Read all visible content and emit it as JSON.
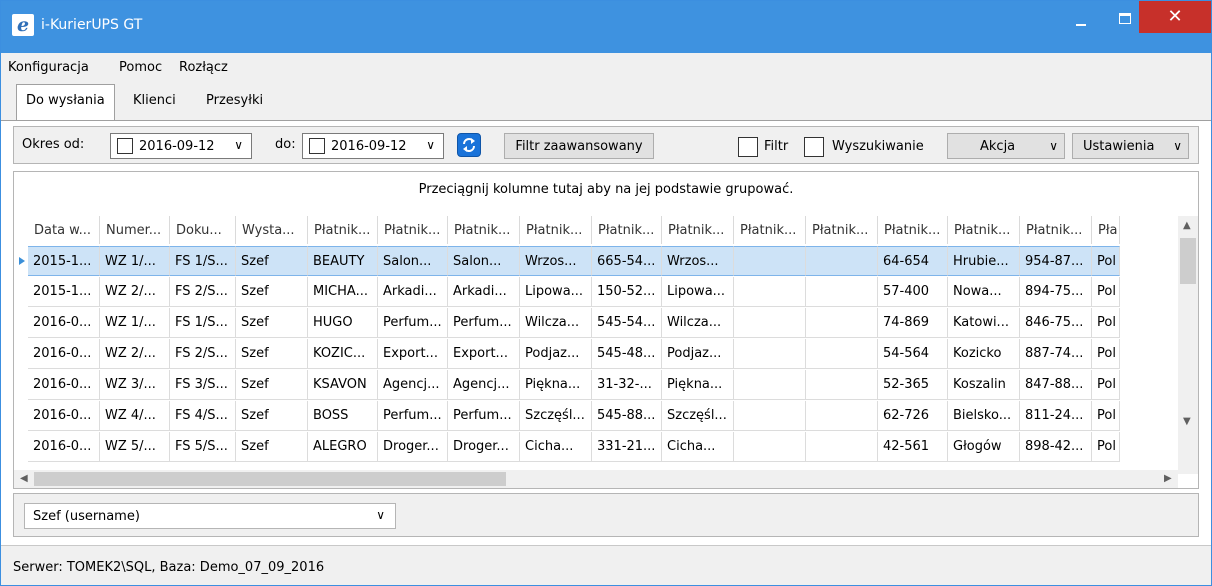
{
  "window": {
    "title": "i-KurierUPS GT",
    "close_glyph": "✕"
  },
  "menu": {
    "items": [
      "Konfiguracja",
      "Pomoc",
      "Rozłącz"
    ]
  },
  "tabs": [
    "Do wysłania",
    "Klienci",
    "Przesyłki"
  ],
  "toolbar": {
    "period_from_label": "Okres od:",
    "date_from": "2016-09-12",
    "to_label": "do:",
    "date_to": "2016-09-12",
    "advanced_filter_label": "Filtr zaawansowany",
    "filter_label": "Filtr",
    "search_label": "Wyszukiwanie",
    "action_label": "Akcja",
    "settings_label": "Ustawienia"
  },
  "grid": {
    "group_hint": "Przeciągnij kolumne tutaj aby na jej podstawie grupować.",
    "columns": [
      "Data w...",
      "Numer...",
      "Doku...",
      "Wysta...",
      "Płatnik...",
      "Płatnik...",
      "Płatnik...",
      "Płatnik...",
      "Płatnik...",
      "Płatnik...",
      "Płatnik...",
      "Płatnik...",
      "Płatnik...",
      "Płatnik...",
      "Płatnik...",
      "Pła"
    ],
    "rows": [
      [
        "2015-1...",
        "WZ 1/...",
        "FS 1/S...",
        "Szef",
        "BEAUTY",
        "Salon...",
        "Salon...",
        "Wrzos...",
        "665-54...",
        "Wrzos...",
        "",
        "",
        "64-654",
        "Hrubie...",
        "954-87...",
        "Pol"
      ],
      [
        "2015-1...",
        "WZ 2/...",
        "FS 2/S...",
        "Szef",
        "MICHA...",
        "Arkadi...",
        "Arkadi...",
        "Lipowa...",
        "150-52...",
        "Lipowa...",
        "",
        "",
        "57-400",
        "Nowa...",
        "894-75...",
        "Pol"
      ],
      [
        "2016-0...",
        "WZ 1/...",
        "FS 1/S...",
        "Szef",
        "HUGO",
        "Perfum...",
        "Perfum...",
        "Wilcza...",
        "545-54...",
        "Wilcza...",
        "",
        "",
        "74-869",
        "Katowi...",
        "846-75...",
        "Pol"
      ],
      [
        "2016-0...",
        "WZ 2/...",
        "FS 2/S...",
        "Szef",
        "KOZIC...",
        "Export...",
        "Export...",
        "Podjaz...",
        "545-48...",
        "Podjaz...",
        "",
        "",
        "54-564",
        "Kozicko",
        "887-74...",
        "Pol"
      ],
      [
        "2016-0...",
        "WZ 3/...",
        "FS 3/S...",
        "Szef",
        "KSAVON",
        "Agencj...",
        "Agencj...",
        "Piękna...",
        "31-32-...",
        "Piękna...",
        "",
        "",
        "52-365",
        "Koszalin",
        "847-88...",
        "Pol"
      ],
      [
        "2016-0...",
        "WZ 4/...",
        "FS 4/S...",
        "Szef",
        "BOSS",
        "Perfum...",
        "Perfum...",
        "Szczęśl...",
        "545-88...",
        "Szczęśl...",
        "",
        "",
        "62-726",
        "Bielsko...",
        "811-24...",
        "Pol"
      ],
      [
        "2016-0...",
        "WZ 5/...",
        "FS 5/S...",
        "Szef",
        "ALEGRO",
        "Droger...",
        "Droger...",
        "Cicha...",
        "331-21...",
        "Cicha...",
        "",
        "",
        "42-561",
        "Głogów",
        "898-42...",
        "Pol"
      ]
    ],
    "selected_row": 0
  },
  "user": {
    "selected": "Szef  (username)"
  },
  "status": {
    "text": "Serwer: TOMEK2\\SQL, Baza: Demo_07_09_2016"
  },
  "icons": {
    "app": "ie-logo-icon",
    "refresh": "refresh-icon",
    "dropdown": "chevron-down-icon"
  },
  "colors": {
    "titlebar": "#3e92e0",
    "close": "#c7302a",
    "selection": "#cde3f7",
    "refresh": "#1a73d9"
  }
}
